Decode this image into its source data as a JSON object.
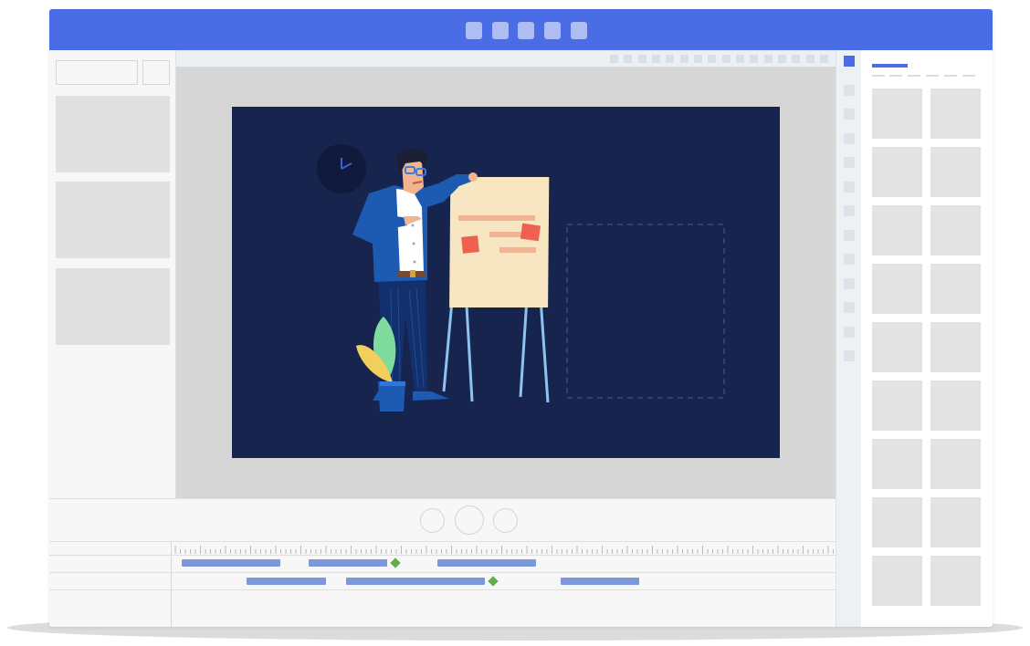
{
  "window": {
    "titlebar_buttons": [
      "menu-button-1",
      "menu-button-2",
      "menu-button-3",
      "menu-button-4",
      "menu-button-5"
    ],
    "accent_color": "#4a6de5"
  },
  "left_panel": {
    "input_primary": "",
    "input_secondary": "",
    "thumbnails": 3
  },
  "slide": {
    "background_color": "#17244e",
    "illustration": "presenter-at-flipchart",
    "placeholder": "dashed-drop-zone"
  },
  "playback": {
    "controls": [
      "previous-button",
      "play-button",
      "next-button"
    ]
  },
  "timeline": {
    "clip_color": "#7d97dd",
    "keyframe_color": "#5fae4a"
  },
  "right_panel": {
    "tile_rows": 9,
    "tile_columns": 2
  }
}
